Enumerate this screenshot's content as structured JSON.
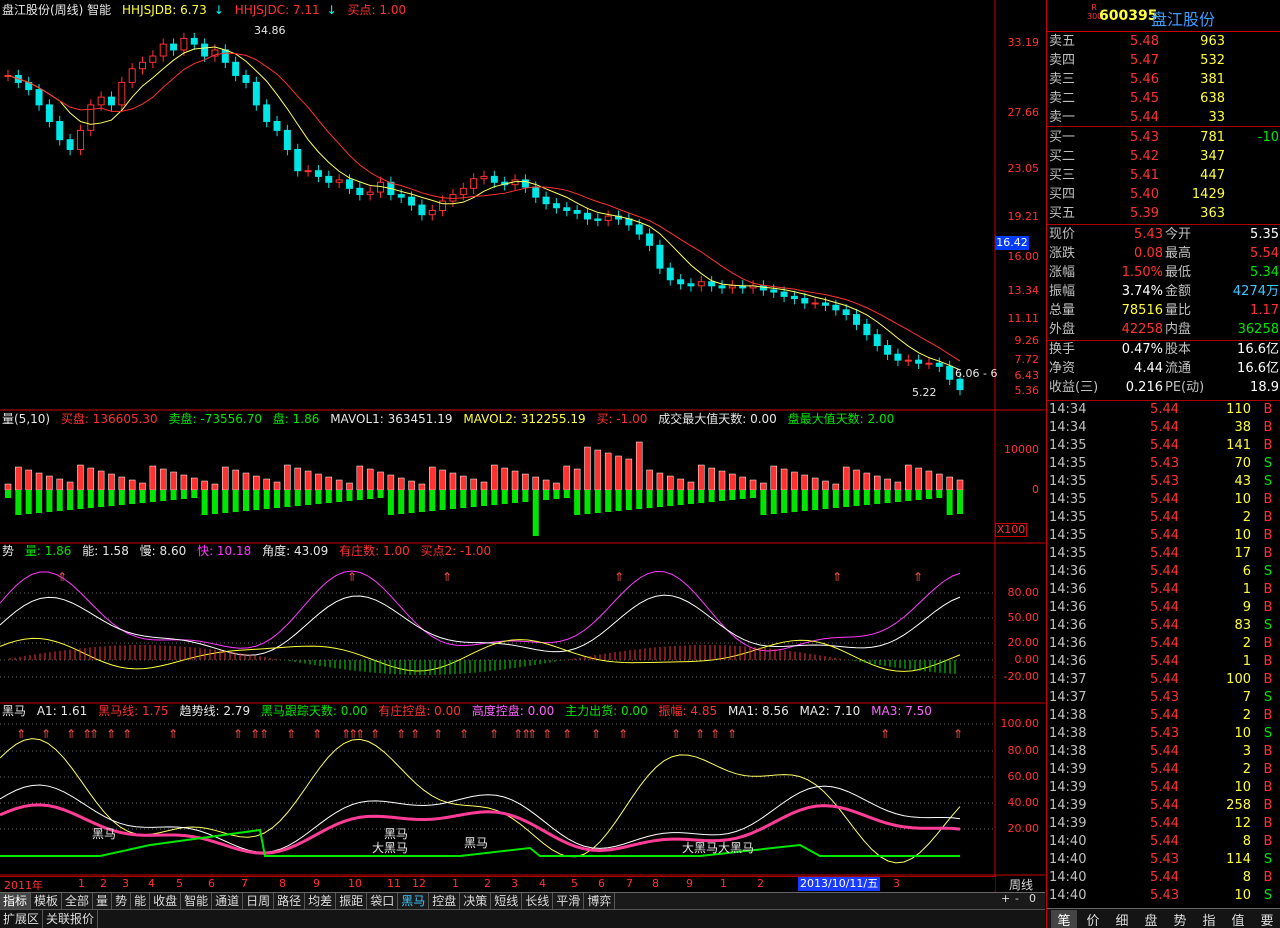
{
  "main_header": {
    "title": "盘江股份(周线) 智能",
    "hhjsjdb": "HHJSJDB: 6.73",
    "hhjsjdc": "HHJSJDC: 7.11",
    "buy_point": "买点: 1.00"
  },
  "price_axis": [
    "33.19",
    "27.66",
    "23.05",
    "19.21",
    "16.00",
    "13.34",
    "11.11",
    "9.26",
    "7.72",
    "6.43",
    "5.36"
  ],
  "current_price_tag": "16.42",
  "annotations": {
    "high": "34.86",
    "low": "5.22",
    "right_value": "6.06 - 6"
  },
  "vol_header": {
    "name": "量(5,10)",
    "buy_vol": "买盘: 136605.30",
    "sell_vol": "卖盘: -73556.70",
    "pan": "盘: 1.86",
    "mavol1": "MAVOL1: 363451.19",
    "mavol2": "MAVOL2: 312255.19",
    "mai": "买: -1.00",
    "max_days": "成交最大值天数: 0.00",
    "pan_max_days": "盘最大值天数: 2.00"
  },
  "vol_axis": [
    "10000",
    "0"
  ],
  "vol_unit": "X100",
  "trend_header": {
    "name": "势",
    "liang": "量: 1.86",
    "neng": "能: 1.58",
    "man": "慢: 8.60",
    "kuai": "快: 10.18",
    "jiaodu": "角度: 43.09",
    "youzhuang": "有庄数: 1.00",
    "maidian2": "买点2: -1.00"
  },
  "trend_axis": [
    "80.00",
    "50.00",
    "20.00",
    "0.00",
    "-20.00"
  ],
  "heima_header": {
    "name": "黑马",
    "a1": "A1: 1.61",
    "heimaxian": "黑马线: 1.75",
    "qushixian": "趋势线: 2.79",
    "genzong": "黑马跟踪天数: 0.00",
    "youzhuang": "有庄控盘: 0.00",
    "gaodu": "高度控盘: 0.00",
    "zhuli": "主力出货: 0.00",
    "zhenfu": "振幅: 4.85",
    "ma1": "MA1: 8.56",
    "ma2": "MA2: 7.10",
    "ma3": "MA3: 7.50"
  },
  "heima_axis": [
    "100.00",
    "80.00",
    "60.00",
    "40.00",
    "20.00"
  ],
  "heima_labels": [
    "黑马",
    "黑马",
    "大黑马",
    "黑马",
    "大黑马大黑马"
  ],
  "time_axis": {
    "year": "2011年",
    "months": [
      "1",
      "2",
      "3",
      "4",
      "5",
      "6",
      "7",
      "8",
      "9",
      "10",
      "11",
      "12",
      "1",
      "2",
      "3",
      "4",
      "5",
      "6",
      "7",
      "8",
      "9",
      "1",
      "2",
      "3"
    ],
    "cursor_date": "2013/10/11/五",
    "period": "周线"
  },
  "tabs": [
    "指标",
    "模板",
    "全部",
    "量",
    "势",
    "能",
    "收盘",
    "智能",
    "通道",
    "日周",
    "路径",
    "均差",
    "振距",
    "袋口",
    "黑马",
    "控盘",
    "决策",
    "短线",
    "长线",
    "平滑",
    "博弈"
  ],
  "active_tab": "指标",
  "bottom_tabs": [
    "扩展区",
    "关联报价"
  ],
  "zoom_controls": [
    "+",
    "-",
    "0"
  ],
  "stock": {
    "badge": "R 300",
    "code": "600395",
    "name": "盘江股份"
  },
  "sell_orders": [
    {
      "label": "卖五",
      "price": "5.48",
      "vol": "963"
    },
    {
      "label": "卖四",
      "price": "5.47",
      "vol": "532"
    },
    {
      "label": "卖三",
      "price": "5.46",
      "vol": "381"
    },
    {
      "label": "卖二",
      "price": "5.45",
      "vol": "638"
    },
    {
      "label": "卖一",
      "price": "5.44",
      "vol": "33"
    }
  ],
  "buy_orders": [
    {
      "label": "买一",
      "price": "5.43",
      "vol": "781",
      "chg": "-10"
    },
    {
      "label": "买二",
      "price": "5.42",
      "vol": "347",
      "chg": ""
    },
    {
      "label": "买三",
      "price": "5.41",
      "vol": "447",
      "chg": ""
    },
    {
      "label": "买四",
      "price": "5.40",
      "vol": "1429",
      "chg": ""
    },
    {
      "label": "买五",
      "price": "5.39",
      "vol": "363",
      "chg": ""
    }
  ],
  "quote": [
    {
      "l1": "现价",
      "v1": "5.43",
      "l2": "今开",
      "v2": "5.35"
    },
    {
      "l1": "涨跌",
      "v1": "0.08",
      "l2": "最高",
      "v2": "5.54"
    },
    {
      "l1": "涨幅",
      "v1": "1.50%",
      "l2": "最低",
      "v2": "5.34"
    },
    {
      "l1": "振幅",
      "v1": "3.74%",
      "l2": "金额",
      "v2": "4274万"
    },
    {
      "l1": "总量",
      "v1": "78516",
      "l2": "量比",
      "v2": "1.17"
    },
    {
      "l1": "外盘",
      "v1": "42258",
      "l2": "内盘",
      "v2": "36258"
    }
  ],
  "finance": [
    {
      "l1": "换手",
      "v1": "0.47%",
      "l2": "股本",
      "v2": "16.6亿"
    },
    {
      "l1": "净资",
      "v1": "4.44",
      "l2": "流通",
      "v2": "16.6亿"
    },
    {
      "l1": "收益(三)",
      "v1": "0.216",
      "l2": "PE(动)",
      "v2": "18.9"
    }
  ],
  "ticks": [
    [
      "14:34",
      "5.44",
      "110",
      "B"
    ],
    [
      "14:34",
      "5.44",
      "38",
      "B"
    ],
    [
      "14:35",
      "5.44",
      "141",
      "B"
    ],
    [
      "14:35",
      "5.43",
      "70",
      "S"
    ],
    [
      "14:35",
      "5.43",
      "43",
      "S"
    ],
    [
      "14:35",
      "5.44",
      "10",
      "B"
    ],
    [
      "14:35",
      "5.44",
      "2",
      "B"
    ],
    [
      "14:35",
      "5.44",
      "10",
      "B"
    ],
    [
      "14:35",
      "5.44",
      "17",
      "B"
    ],
    [
      "14:36",
      "5.44",
      "6",
      "S"
    ],
    [
      "14:36",
      "5.44",
      "1",
      "B"
    ],
    [
      "14:36",
      "5.44",
      "9",
      "B"
    ],
    [
      "14:36",
      "5.44",
      "83",
      "S"
    ],
    [
      "14:36",
      "5.44",
      "2",
      "B"
    ],
    [
      "14:36",
      "5.44",
      "1",
      "B"
    ],
    [
      "14:37",
      "5.44",
      "100",
      "B"
    ],
    [
      "14:37",
      "5.43",
      "7",
      "S"
    ],
    [
      "14:38",
      "5.44",
      "2",
      "B"
    ],
    [
      "14:38",
      "5.43",
      "10",
      "S"
    ],
    [
      "14:38",
      "5.44",
      "3",
      "B"
    ],
    [
      "14:39",
      "5.44",
      "2",
      "B"
    ],
    [
      "14:39",
      "5.44",
      "10",
      "B"
    ],
    [
      "14:39",
      "5.44",
      "258",
      "B"
    ],
    [
      "14:39",
      "5.44",
      "12",
      "B"
    ],
    [
      "14:40",
      "5.44",
      "8",
      "B"
    ],
    [
      "14:40",
      "5.43",
      "114",
      "S"
    ],
    [
      "14:40",
      "5.44",
      "8",
      "B"
    ],
    [
      "14:40",
      "5.43",
      "10",
      "S"
    ]
  ],
  "right_tabs": [
    "笔",
    "价",
    "细",
    "盘",
    "势",
    "指",
    "值",
    "要"
  ],
  "colors": {
    "up": "#ff3232",
    "down": "#00e6e6",
    "grid": "#a00000",
    "ma_yellow": "#ffff64",
    "ma_red": "#ff3232"
  }
}
